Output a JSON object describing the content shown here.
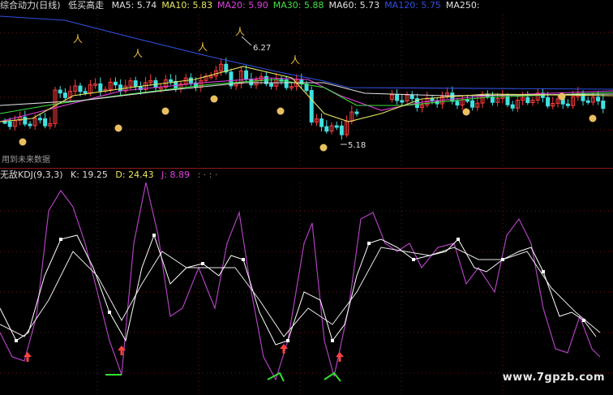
{
  "header_main": {
    "title": "综合动力(日线)",
    "subtitle": "低买高走",
    "ma": [
      {
        "label": "MA5: 5.74",
        "color": "#e0e0e0"
      },
      {
        "label": "MA10: 5.83",
        "color": "#e8e860"
      },
      {
        "label": "MA20: 5.90",
        "color": "#e040e0"
      },
      {
        "label": "MA30: 5.88",
        "color": "#40e040"
      },
      {
        "label": "MA60: 5.73",
        "color": "#e0e0e0"
      },
      {
        "label": "MA120: 5.75",
        "color": "#3050e0"
      },
      {
        "label": "MA250:",
        "color": "#e0e0e0"
      }
    ]
  },
  "header_kdj": {
    "title": "无敌KDJ(9,3,3)",
    "k": "K: 19.25",
    "d": "D: 24.43",
    "j": "J: 8.89",
    "dots": ": · : ·"
  },
  "note": "用到未来数据",
  "watermark": "www.7gpzb.com",
  "chart_data": [
    {
      "type": "candlestick",
      "annotations": [
        {
          "label": "6.27",
          "kind": "high"
        },
        {
          "label": "5.18",
          "kind": "low"
        }
      ],
      "signals": {
        "buy_marker": "money-bag-icon",
        "sell_marker": "figure-icon"
      },
      "ma_series": [
        "MA5",
        "MA10",
        "MA20",
        "MA30",
        "MA60",
        "MA120",
        "MA250"
      ]
    },
    {
      "type": "line",
      "series": [
        {
          "name": "K",
          "color": "#ffffff"
        },
        {
          "name": "D",
          "color": "#ffffff"
        },
        {
          "name": "J",
          "color": "#b040c0"
        }
      ]
    }
  ]
}
